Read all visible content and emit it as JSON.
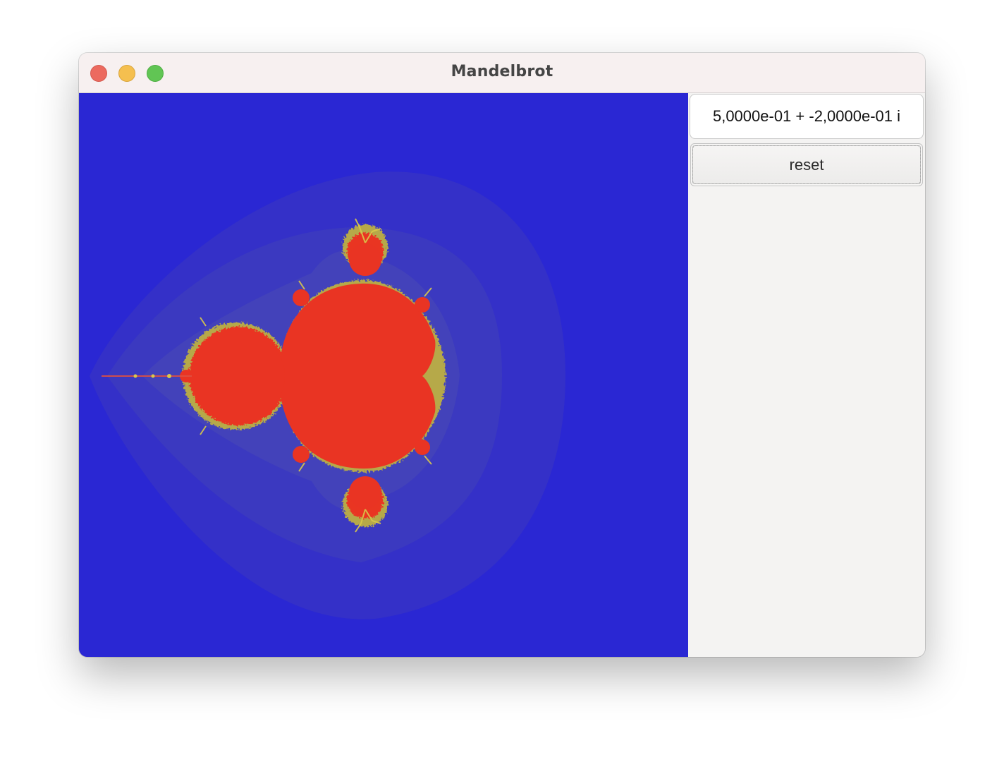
{
  "window": {
    "title": "Mandelbrot"
  },
  "controls": {
    "complex_value": "5,0000e-01 + -2,0000e-01 i",
    "reset_label": "reset"
  },
  "colors": {
    "background": "#2a27d3",
    "set_interior": "#e93423",
    "boundary_highlight": "#e7d84a",
    "halo": "#4646b8"
  }
}
